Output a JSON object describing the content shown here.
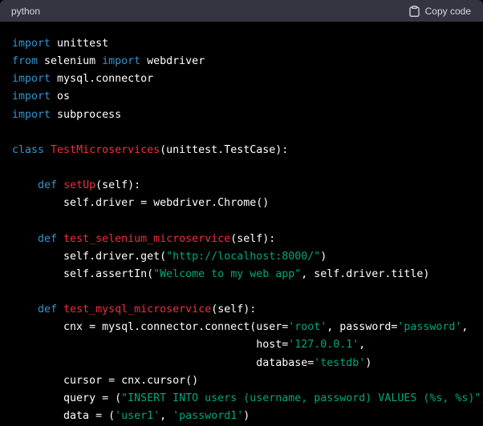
{
  "header": {
    "language": "python",
    "copy_label": "Copy code"
  },
  "colors": {
    "header_bg": "#343541",
    "code_bg": "#000000",
    "keyword": "#2e95d3",
    "class_name": "#f22c3d",
    "function_name": "#f22c3d",
    "string": "#00a67d",
    "text": "#ffffff"
  },
  "icons": {
    "copy": "clipboard-icon"
  },
  "code_lines": [
    [
      {
        "t": "kw",
        "v": "import"
      },
      {
        "t": "txt",
        "v": " unittest"
      }
    ],
    [
      {
        "t": "kw",
        "v": "from"
      },
      {
        "t": "txt",
        "v": " selenium "
      },
      {
        "t": "kw",
        "v": "import"
      },
      {
        "t": "txt",
        "v": " webdriver"
      }
    ],
    [
      {
        "t": "kw",
        "v": "import"
      },
      {
        "t": "txt",
        "v": " mysql.connector"
      }
    ],
    [
      {
        "t": "kw",
        "v": "import"
      },
      {
        "t": "txt",
        "v": " os"
      }
    ],
    [
      {
        "t": "kw",
        "v": "import"
      },
      {
        "t": "txt",
        "v": " subprocess"
      }
    ],
    [],
    [
      {
        "t": "kw",
        "v": "class"
      },
      {
        "t": "txt",
        "v": " "
      },
      {
        "t": "cls",
        "v": "TestMicroservices"
      },
      {
        "t": "txt",
        "v": "(unittest.TestCase):"
      }
    ],
    [],
    [
      {
        "t": "txt",
        "v": "    "
      },
      {
        "t": "kw",
        "v": "def"
      },
      {
        "t": "txt",
        "v": " "
      },
      {
        "t": "fn",
        "v": "setUp"
      },
      {
        "t": "txt",
        "v": "(self):"
      }
    ],
    [
      {
        "t": "txt",
        "v": "        self.driver = webdriver.Chrome()"
      }
    ],
    [],
    [
      {
        "t": "txt",
        "v": "    "
      },
      {
        "t": "kw",
        "v": "def"
      },
      {
        "t": "txt",
        "v": " "
      },
      {
        "t": "fn",
        "v": "test_selenium_microservice"
      },
      {
        "t": "txt",
        "v": "(self):"
      }
    ],
    [
      {
        "t": "txt",
        "v": "        self.driver.get("
      },
      {
        "t": "str",
        "v": "\"http://localhost:8000/\""
      },
      {
        "t": "txt",
        "v": ")"
      }
    ],
    [
      {
        "t": "txt",
        "v": "        self.assertIn("
      },
      {
        "t": "str",
        "v": "\"Welcome to my web app\""
      },
      {
        "t": "txt",
        "v": ", self.driver.title)"
      }
    ],
    [],
    [
      {
        "t": "txt",
        "v": "    "
      },
      {
        "t": "kw",
        "v": "def"
      },
      {
        "t": "txt",
        "v": " "
      },
      {
        "t": "fn",
        "v": "test_mysql_microservice"
      },
      {
        "t": "txt",
        "v": "(self):"
      }
    ],
    [
      {
        "t": "txt",
        "v": "        cnx = mysql.connector.connect(user="
      },
      {
        "t": "str",
        "v": "'root'"
      },
      {
        "t": "txt",
        "v": ", password="
      },
      {
        "t": "str",
        "v": "'password'"
      },
      {
        "t": "txt",
        "v": ","
      }
    ],
    [
      {
        "t": "txt",
        "v": "                                      host="
      },
      {
        "t": "str",
        "v": "'127.0.0.1'"
      },
      {
        "t": "txt",
        "v": ","
      }
    ],
    [
      {
        "t": "txt",
        "v": "                                      database="
      },
      {
        "t": "str",
        "v": "'testdb'"
      },
      {
        "t": "txt",
        "v": ")"
      }
    ],
    [
      {
        "t": "txt",
        "v": "        cursor = cnx.cursor()"
      }
    ],
    [
      {
        "t": "txt",
        "v": "        query = ("
      },
      {
        "t": "str",
        "v": "\"INSERT INTO users (username, password) VALUES (%s, %s)\""
      },
      {
        "t": "txt",
        "v": ")"
      }
    ],
    [
      {
        "t": "txt",
        "v": "        data = ("
      },
      {
        "t": "str",
        "v": "'user1'"
      },
      {
        "t": "txt",
        "v": ", "
      },
      {
        "t": "str",
        "v": "'password1'"
      },
      {
        "t": "txt",
        "v": ")"
      }
    ]
  ]
}
